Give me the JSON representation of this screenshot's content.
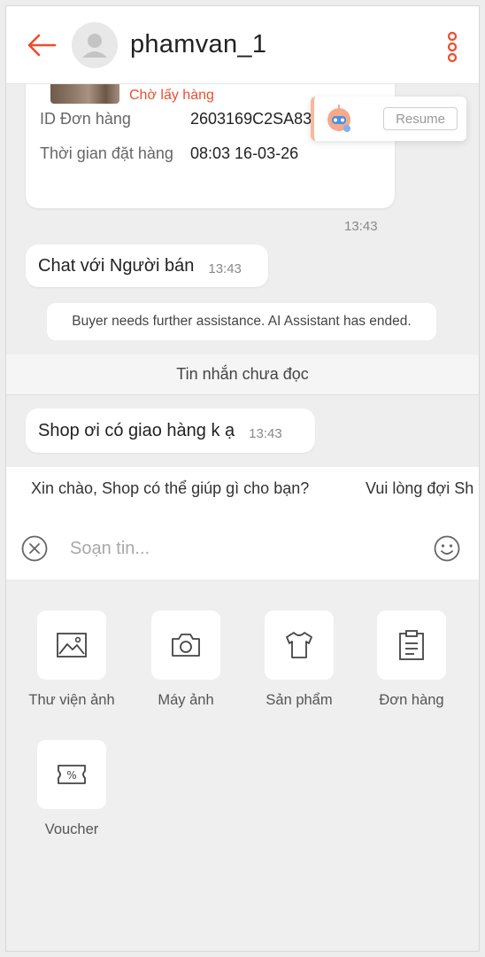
{
  "header": {
    "title": "phamvan_1"
  },
  "order": {
    "status": "Chờ lấy hàng",
    "id_label": "ID Đơn hàng",
    "id_value": "2603169C2SA83T",
    "time_label": "Thời gian đặt hàng",
    "time_value": "08:03 16-03-26",
    "timestamp": "13:43"
  },
  "ai_assistant": {
    "resume_label": "Resume"
  },
  "messages": [
    {
      "text": "Chat với Người bán",
      "time": "13:43"
    },
    {
      "text": "Shop ơi có giao hàng k ạ",
      "time": "13:43"
    }
  ],
  "system_note": "Buyer needs further assistance. AI Assistant has ended.",
  "unread_label": "Tin nhắn chưa đọc",
  "quick_replies": [
    "Xin chào, Shop có thể giúp gì cho bạn?",
    "Vui lòng đợi Sh"
  ],
  "compose": {
    "placeholder": "Soạn tin..."
  },
  "tools": [
    {
      "label": "Thư viện ảnh",
      "icon": "image-icon"
    },
    {
      "label": "Máy ảnh",
      "icon": "camera-icon"
    },
    {
      "label": "Sản phẩm",
      "icon": "shirt-icon"
    },
    {
      "label": "Đơn hàng",
      "icon": "clipboard-icon"
    },
    {
      "label": "Voucher",
      "icon": "voucher-icon"
    }
  ],
  "colors": {
    "accent": "#ee4d2d",
    "background": "#eeeeee"
  }
}
